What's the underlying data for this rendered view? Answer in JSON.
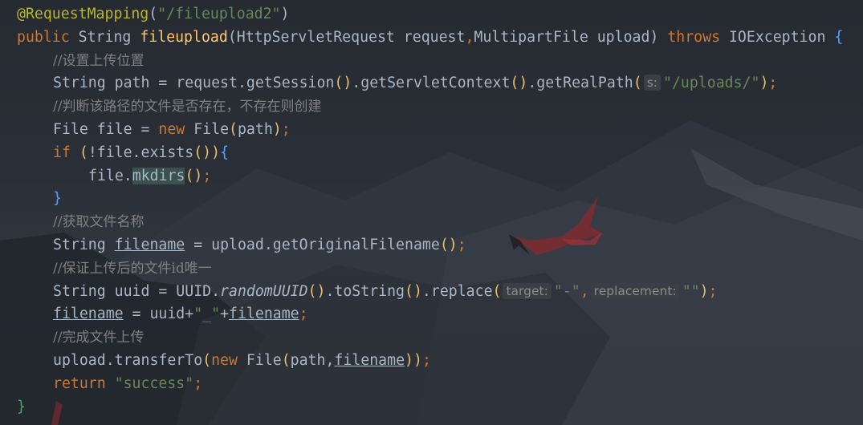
{
  "code_lines": [
    {
      "annotation": "@RequestMapping",
      "open": "(",
      "path": "\"/fileupload2\"",
      "close": ")"
    },
    {
      "kw_public": "public",
      "type_string": " String ",
      "method": "fileupload",
      "open": "(",
      "params": "HttpServletRequest request",
      "comma": ",",
      "params2": "MultipartFile upload",
      "close": ")",
      "kw_throws": " throws ",
      "exception": "IOException ",
      "brace": "{"
    },
    {
      "comment": "//设置上传位置"
    },
    {
      "pre": "String path = request.getSession",
      "p1": "()",
      "mid1": ".getServletContext",
      "p2": "()",
      "mid2": ".getRealPath",
      "open": "(",
      "hint": "s:",
      "arg": "\"/uploads/\"",
      "close": ")",
      "semi": ";"
    },
    {
      "comment": "//判断该路径的文件是否存在，不存在则创建"
    },
    {
      "pre": "File file = ",
      "kw_new": "new",
      "type": " File",
      "open": "(",
      "arg": "path",
      "close": ")",
      "semi": ";"
    },
    {
      "kw_if": "if",
      "sp": " ",
      "open": "(",
      "cond": "!file.exists",
      "call": "()",
      "close": ")",
      "brace": "{"
    },
    {
      "obj": "file.",
      "method": "mkdirs",
      "call": "()",
      "semi": ";"
    },
    {
      "brace": "}"
    },
    {
      "comment": "//获取文件名称"
    },
    {
      "pre": "String ",
      "var": "filename",
      "mid": " = upload.getOriginalFilename",
      "call": "()",
      "semi": ";"
    },
    {
      "comment": "//保证上传后的文件id唯一"
    },
    {
      "pre": "String uuid = UUID.",
      "method": "randomUUID",
      "call": "()",
      "mid": ".toString",
      "call2": "()",
      "mid2": ".replace",
      "open": "(",
      "hint1": "target:",
      "arg1": "\"-\"",
      "comma": ",",
      "hint2": "replacement:",
      "arg2": "\"\"",
      "close": ")",
      "semi": ";"
    },
    {
      "var": "filename",
      "mid": " = uuid+",
      "str": "\"_\"",
      "plus": "+",
      "var2": "filename",
      "semi": ";"
    },
    {
      "comment": "//完成文件上传"
    },
    {
      "pre": "upload.transferTo",
      "open": "(",
      "kw_new": "new",
      "type": " File",
      "open2": "(",
      "arg": "path,",
      "var": "filename",
      "close2": ")",
      "close": ")",
      "semi": ";"
    },
    {
      "kw_return": "return",
      "sp": " ",
      "str": "\"success\"",
      "semi": ";"
    },
    {
      "brace": "}"
    }
  ],
  "colors": {
    "background": "#2b2f36",
    "text": "#a9b7c6",
    "keyword": "#cc7832",
    "string": "#6a8759",
    "method_declaration": "#ffc66d",
    "annotation": "#bbb529",
    "comment": "#808080",
    "matched_brace": "#4fa3ff",
    "paren": "#e8bf6a",
    "inlay_hint_bg": "#3b3f44",
    "inlay_hint_text": "#8c8c8c"
  },
  "background_image": "dark-mountain-landscape-with-red-bird"
}
